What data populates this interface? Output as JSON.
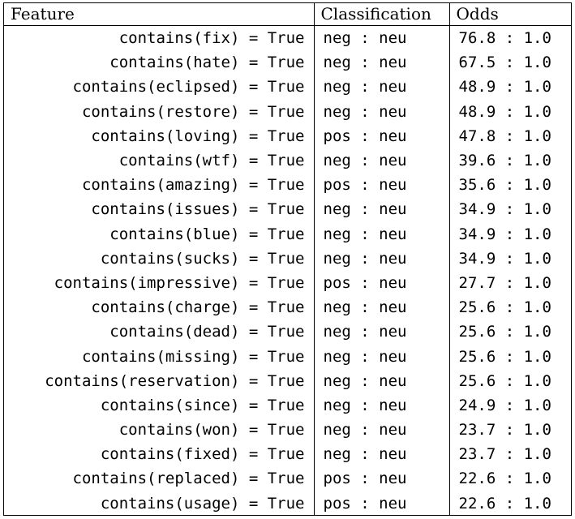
{
  "headers": {
    "feature": "Feature",
    "classification": "Classification",
    "odds": "Odds"
  },
  "rows": [
    {
      "feature": "contains(fix) = True",
      "classification": "neg : neu",
      "odds": "76.8 : 1.0"
    },
    {
      "feature": "contains(hate) = True",
      "classification": "neg : neu",
      "odds": "67.5 : 1.0"
    },
    {
      "feature": "contains(eclipsed) = True",
      "classification": "neg : neu",
      "odds": "48.9 : 1.0"
    },
    {
      "feature": "contains(restore) = True",
      "classification": "neg : neu",
      "odds": "48.9 : 1.0"
    },
    {
      "feature": "contains(loving) = True",
      "classification": "pos : neu",
      "odds": "47.8 : 1.0"
    },
    {
      "feature": "contains(wtf) = True",
      "classification": "neg : neu",
      "odds": "39.6 : 1.0"
    },
    {
      "feature": "contains(amazing) = True",
      "classification": "pos : neu",
      "odds": "35.6 : 1.0"
    },
    {
      "feature": "contains(issues) = True",
      "classification": "neg : neu",
      "odds": "34.9 : 1.0"
    },
    {
      "feature": "contains(blue) = True",
      "classification": "neg : neu",
      "odds": "34.9 : 1.0"
    },
    {
      "feature": "contains(sucks) = True",
      "classification": "neg : neu",
      "odds": "34.9 : 1.0"
    },
    {
      "feature": "contains(impressive) = True",
      "classification": "pos : neu",
      "odds": "27.7 : 1.0"
    },
    {
      "feature": "contains(charge) = True",
      "classification": "neg : neu",
      "odds": "25.6 : 1.0"
    },
    {
      "feature": "contains(dead) = True",
      "classification": "neg : neu",
      "odds": "25.6 : 1.0"
    },
    {
      "feature": "contains(missing) = True",
      "classification": "neg : neu",
      "odds": "25.6 : 1.0"
    },
    {
      "feature": "contains(reservation) = True",
      "classification": "neg : neu",
      "odds": "25.6 : 1.0"
    },
    {
      "feature": "contains(since) = True",
      "classification": "neg : neu",
      "odds": "24.9 : 1.0"
    },
    {
      "feature": "contains(won) = True",
      "classification": "neg : neu",
      "odds": "23.7 : 1.0"
    },
    {
      "feature": "contains(fixed) = True",
      "classification": "neg : neu",
      "odds": "23.7 : 1.0"
    },
    {
      "feature": "contains(replaced) = True",
      "classification": "pos : neu",
      "odds": "22.6 : 1.0"
    },
    {
      "feature": "contains(usage) = True",
      "classification": "pos : neu",
      "odds": "22.6 : 1.0"
    }
  ]
}
